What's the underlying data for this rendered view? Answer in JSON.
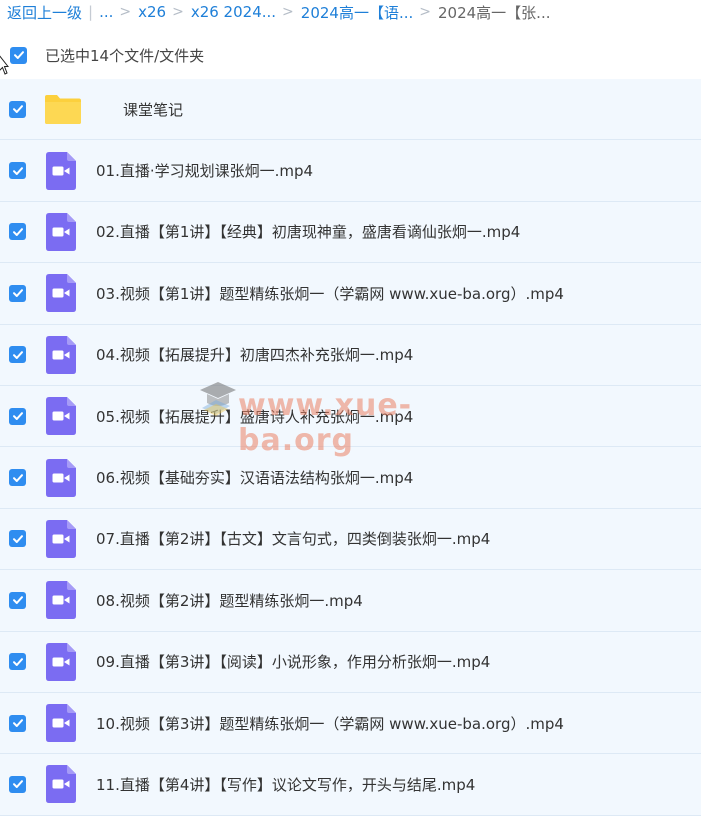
{
  "breadcrumb": {
    "back_label": "返回上一级",
    "ellipsis_label": "...",
    "items": [
      {
        "label": "x26"
      },
      {
        "label": "x26 2024..."
      },
      {
        "label": "2024高一【语..."
      },
      {
        "label": "2024高一【张..."
      }
    ]
  },
  "selection": {
    "label": "已选中14个文件/文件夹",
    "checked": true
  },
  "files": [
    {
      "name": "课堂笔记",
      "type": "folder",
      "checked": true
    },
    {
      "name": "01.直播·学习规划课张炯一.mp4",
      "type": "video",
      "checked": true
    },
    {
      "name": "02.直播【第1讲】【经典】初唐现神童，盛唐看谪仙张炯一.mp4",
      "type": "video",
      "checked": true
    },
    {
      "name": "03.视频【第1讲】题型精练张炯一（学霸网 www.xue-ba.org）.mp4",
      "type": "video",
      "checked": true
    },
    {
      "name": "04.视频【拓展提升】初唐四杰补充张炯一.mp4",
      "type": "video",
      "checked": true
    },
    {
      "name": "05.视频【拓展提升】盛唐诗人补充张炯一.mp4",
      "type": "video",
      "checked": true
    },
    {
      "name": "06.视频【基础夯实】汉语语法结构张炯一.mp4",
      "type": "video",
      "checked": true
    },
    {
      "name": "07.直播【第2讲】【古文】文言句式，四类倒装张炯一.mp4",
      "type": "video",
      "checked": true
    },
    {
      "name": "08.视频【第2讲】题型精练张炯一.mp4",
      "type": "video",
      "checked": true
    },
    {
      "name": "09.直播【第3讲】【阅读】小说形象，作用分析张炯一.mp4",
      "type": "video",
      "checked": true
    },
    {
      "name": "10.视频【第3讲】题型精练张炯一（学霸网 www.xue-ba.org）.mp4",
      "type": "video",
      "checked": true
    },
    {
      "name": "11.直播【第4讲】【写作】议论文写作，开头与结尾.mp4",
      "type": "video",
      "checked": true
    }
  ],
  "watermark": {
    "text": "www.xue-ba.org"
  },
  "colors": {
    "link": "#1e7fd8",
    "checkbox": "#2f8df0",
    "row_background": "#f2f8fe",
    "video_icon": "#7b6cf2",
    "folder_icon": "#fcd03d"
  },
  "icons": {
    "checkbox": "check-icon",
    "video": "video-file-icon",
    "folder": "folder-icon",
    "cursor": "mouse-cursor-icon",
    "watermark": "graduation-cap-icon"
  }
}
